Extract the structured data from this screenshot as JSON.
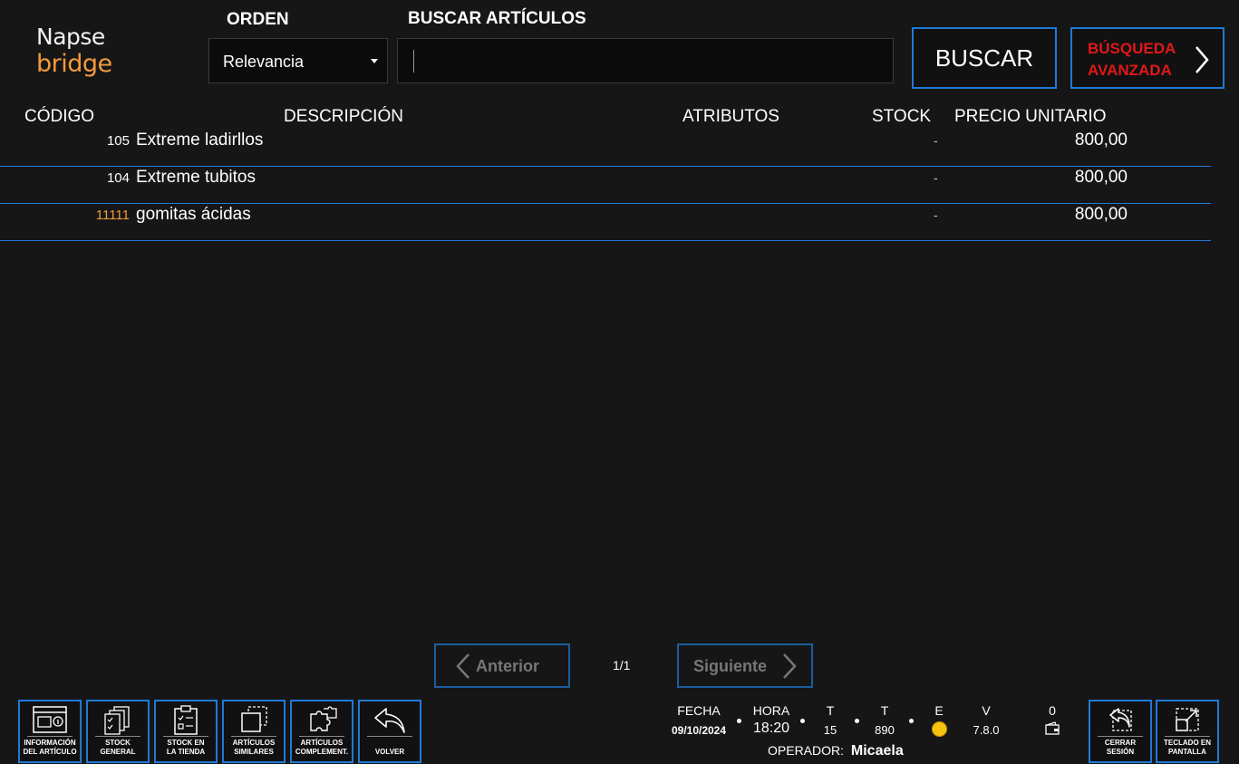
{
  "brand": {
    "line1": "Napse",
    "line2": "bridge"
  },
  "order": {
    "label": "ORDEN",
    "value": "Relevancia"
  },
  "search": {
    "label": "BUSCAR ARTÍCULOS",
    "value": "",
    "button": "BUSCAR",
    "advanced_line1": "BÚSQUEDA",
    "advanced_line2": "AVANZADA"
  },
  "table": {
    "headers": {
      "code": "CÓDIGO",
      "description": "DESCRIPCIÓN",
      "attributes": "ATRIBUTOS",
      "stock": "STOCK",
      "price": "PRECIO UNITARIO"
    },
    "rows": [
      {
        "code": "105",
        "description": "Extreme ladirllos",
        "attributes": "",
        "stock": "-",
        "price": "800,00"
      },
      {
        "code": "104",
        "description": "Extreme tubitos",
        "attributes": "",
        "stock": "-",
        "price": "800,00"
      },
      {
        "code": "11111",
        "description": "gomitas ácidas",
        "attributes": "",
        "stock": "-",
        "price": "800,00"
      }
    ]
  },
  "pagination": {
    "prev": "Anterior",
    "next": "Siguiente",
    "page": "1/1"
  },
  "toolbar": [
    {
      "icon": "article-info-icon",
      "line1": "INFORMACIÓN",
      "line2": "DEL ARTÍCULO"
    },
    {
      "icon": "stock-general-icon",
      "line1": "STOCK",
      "line2": "GENERAL"
    },
    {
      "icon": "store-stock-icon",
      "line1": "STOCK EN",
      "line2": "LA TIENDA"
    },
    {
      "icon": "similar-articles-icon",
      "line1": "ARTÍCULOS",
      "line2": "SIMILARES"
    },
    {
      "icon": "puzzle-icon",
      "line1": "ARTÍCULOS",
      "line2": "COMPLEMENT."
    },
    {
      "icon": "back-arrow-icon",
      "line1": "",
      "line2": "VOLVER"
    }
  ],
  "status": {
    "fecha_label": "FECHA",
    "fecha": "09/10/2024",
    "hora_label": "HORA",
    "hora": "18:20",
    "t1_label": "T",
    "t1": "15",
    "t2_label": "T",
    "t2": "890",
    "e_label": "E",
    "v_label": "V",
    "v": "7.8.0",
    "count": "0",
    "operator_label": "OPERADOR:",
    "operator": "Micaela"
  },
  "right_buttons": [
    {
      "icon": "logout-icon",
      "line1": "CERRAR",
      "line2": "SESIÓN"
    },
    {
      "icon": "keyboard-expand-icon",
      "line1": "TECLADO EN",
      "line2": "PANTALLA"
    }
  ],
  "colors": {
    "accent": "#1f7ad6",
    "brand_orange": "#f39a3c",
    "advanced_red": "#e01818",
    "status_yellow": "#f5c20f",
    "background": "#161616"
  }
}
